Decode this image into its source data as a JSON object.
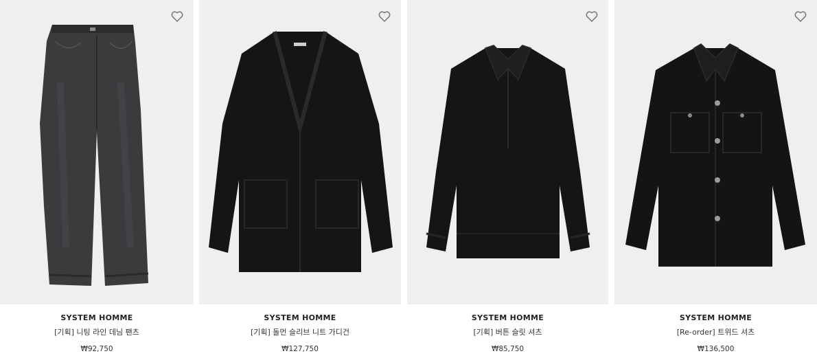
{
  "products": [
    {
      "brand": "SYSTEM HOMME",
      "name": "[기획] 니팅 라인 데님 팬츠",
      "price": "₩92,750",
      "image": "gray-denim-jeans",
      "icon": "heart-outline-icon"
    },
    {
      "brand": "SYSTEM HOMME",
      "name": "[기획] 돌먼 슬리브 니트 가디건",
      "price": "₩127,750",
      "image": "black-knit-cardigan",
      "icon": "heart-outline-icon"
    },
    {
      "brand": "SYSTEM HOMME",
      "name": "[기획] 버튼 슬릿 셔츠",
      "price": "₩85,750",
      "image": "black-button-slit-shirt",
      "icon": "heart-outline-icon"
    },
    {
      "brand": "SYSTEM HOMME",
      "name": "[Re-order] 트위드 셔츠",
      "price": "₩136,500",
      "image": "black-tweed-shirt",
      "icon": "heart-outline-icon"
    }
  ],
  "colors": {
    "image_bg": "#efefef",
    "garment_black": "#151515",
    "denim_gray": "#3b3b3e"
  }
}
